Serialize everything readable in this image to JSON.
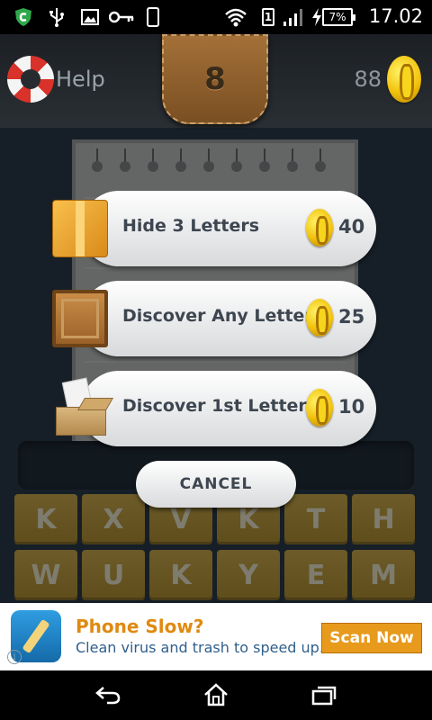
{
  "status_bar": {
    "time": "17.02",
    "battery_percent": "7%",
    "sim_label": "1",
    "icons": [
      "shield-app-icon",
      "usb-icon",
      "image-icon",
      "key-icon",
      "phone-icon",
      "wifi-icon",
      "sim-icon",
      "signal-icon",
      "battery-charging-icon"
    ]
  },
  "header": {
    "help_label": "Help",
    "level": "8",
    "coins": "88"
  },
  "dialog": {
    "options": [
      {
        "label": "Hide 3 Letters",
        "cost": "40",
        "icon": "gold-box-icon"
      },
      {
        "label": "Discover Any Letter",
        "cost": "25",
        "icon": "wooden-crate-icon"
      },
      {
        "label": "Discover 1st Letter",
        "cost": "10",
        "icon": "open-box-icon"
      }
    ],
    "cancel_label": "CANCEL"
  },
  "keyboard": {
    "keys": [
      "K",
      "X",
      "V",
      "K",
      "T",
      "H",
      "W",
      "U",
      "K",
      "Y",
      "E",
      "M"
    ]
  },
  "ad": {
    "title": "Phone Slow?",
    "subtitle": "Clean virus and trash to speed up.",
    "button_label": "Scan Now",
    "info_glyph": "i"
  },
  "colors": {
    "coin_gold": "#f2c20c",
    "key_gold": "#d9a92e",
    "ad_orange": "#e79a1c"
  }
}
